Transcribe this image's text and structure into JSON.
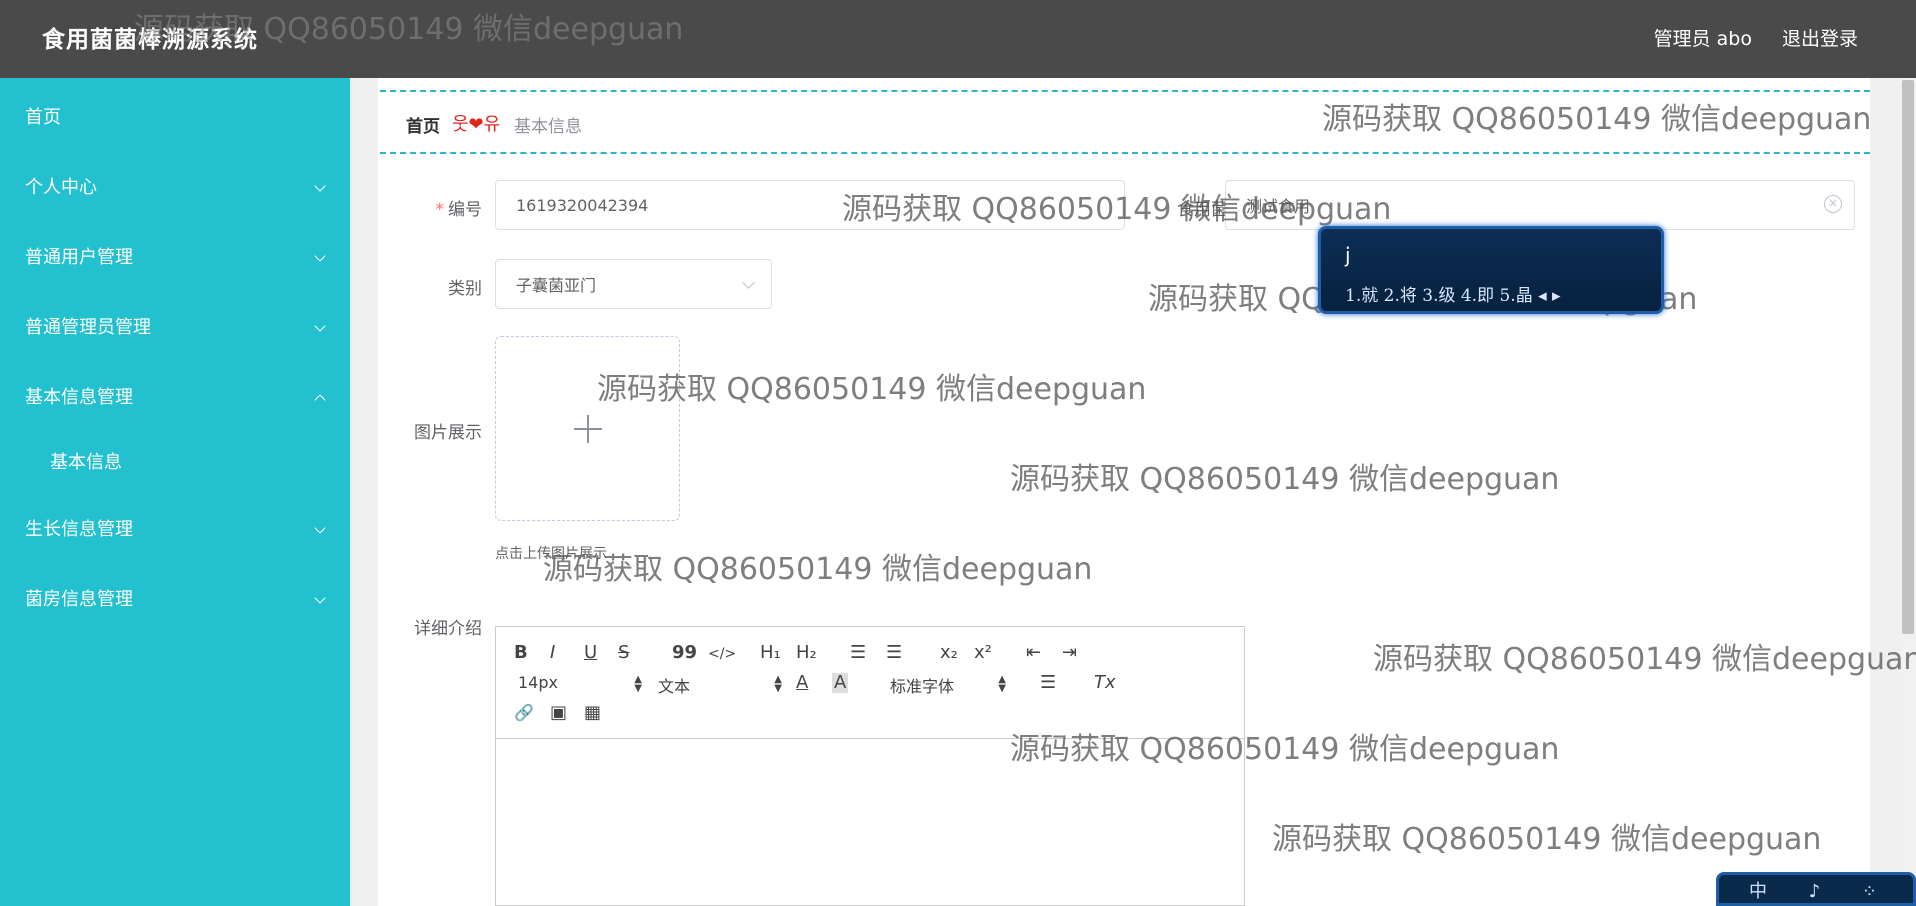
{
  "app": {
    "title": "食用菌菌棒溯源系统"
  },
  "header": {
    "user": "管理员 abo",
    "logout": "退出登录"
  },
  "sidebar": {
    "items": [
      {
        "label": "首页"
      },
      {
        "label": "个人中心"
      },
      {
        "label": "普通用户管理"
      },
      {
        "label": "普通管理员管理"
      },
      {
        "label": "基本信息管理"
      },
      {
        "label": "基本信息"
      },
      {
        "label": "生长信息管理"
      },
      {
        "label": "菌房信息管理"
      }
    ]
  },
  "breadcrumb": {
    "home": "首页",
    "separator": "웃❤유",
    "current": "基本信息"
  },
  "form": {
    "code": {
      "label": "编号",
      "value": "1619320042394"
    },
    "name": {
      "label": "食用菌",
      "value": "测试食用"
    },
    "category": {
      "label": "类别",
      "value": "子囊菌亚门"
    },
    "image": {
      "label": "图片展示",
      "tip": "点击上传图片展示"
    },
    "detail": {
      "label": "详细介绍"
    }
  },
  "editor": {
    "font_size": "14px",
    "header_select": "文本",
    "font_family": "标准字体",
    "tools": {
      "bold": "B",
      "italic": "I",
      "underline": "U",
      "strike": "S",
      "quote": "99",
      "code": "</>",
      "h1": "H₁",
      "h2": "H₂",
      "ordered": "☰",
      "bullet": "☰",
      "sub": "x₂",
      "sup": "x²",
      "outdent": "⇤",
      "indent": "⇥",
      "color": "A",
      "background": "A",
      "align": "☰",
      "clean": "Tx",
      "link": "🔗",
      "image": "▣",
      "video": "▦"
    }
  },
  "ime": {
    "input": "j",
    "candidates": "1.就 2.将 3.级 4.即 5.晶 ◂ ▸",
    "tray": "中 ♪ ⁘ ⚙"
  },
  "watermark": "源码获取 QQ86050149 微信deepguan"
}
